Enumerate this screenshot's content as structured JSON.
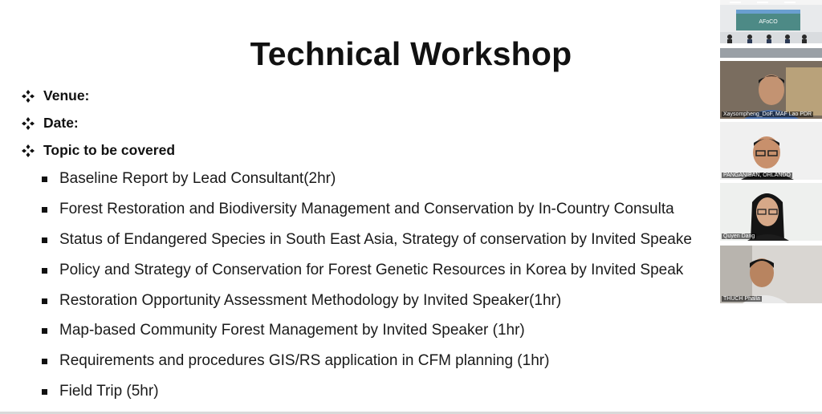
{
  "slide": {
    "title": "Technical Workshop",
    "headers": [
      {
        "label": "Venue:"
      },
      {
        "label": "Date:"
      },
      {
        "label": "Topic to be covered"
      }
    ],
    "topics": [
      "Baseline Report by Lead Consultant(2hr)",
      "Forest Restoration and Biodiversity Management and Conservation by In-Country Consulta",
      "Status of Endangered Species in South East Asia, Strategy of conservation by Invited Speake",
      "Policy and Strategy of Conservation for Forest Genetic Resources in Korea by Invited Speak",
      "Restoration Opportunity Assessment Methodology by Invited Speaker(1hr)",
      "Map-based Community Forest Management by Invited Speaker (1hr)",
      "Requirements and procedures GIS/RS application in CFM planning (1hr)",
      "Field Trip (5hr)"
    ]
  },
  "participants": [
    {
      "name": "",
      "banner": "AFoCO"
    },
    {
      "name": "Xaysompheng_DoF, MAF Lao PDR"
    },
    {
      "name": "PANGANIBAN, ORLANDO"
    },
    {
      "name": "Quyen Dang"
    },
    {
      "name": "THUCH Phalla"
    }
  ]
}
